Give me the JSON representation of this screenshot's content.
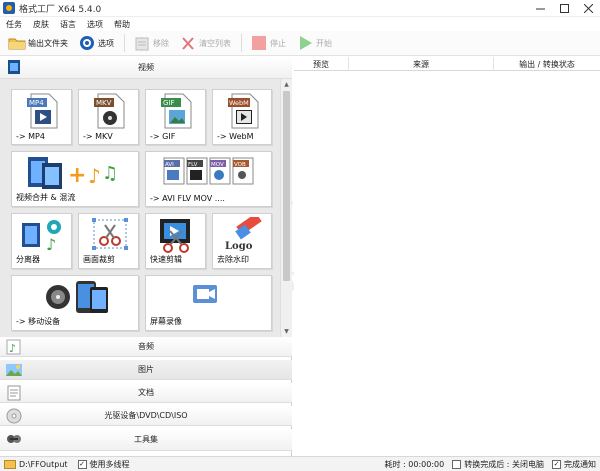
{
  "window": {
    "title": "格式工厂 X64 5.4.0"
  },
  "menu": {
    "items": [
      "任务",
      "皮肤",
      "语言",
      "选项",
      "帮助"
    ]
  },
  "toolbar": {
    "output_folder": "输出文件夹",
    "options": "选项",
    "remove": "移除",
    "clear_list": "清空列表",
    "stop": "停止",
    "start": "开始"
  },
  "categories": {
    "video": "视频",
    "audio": "音频",
    "image": "图片",
    "document": "文档",
    "rom": "光驱设备\\DVD\\CD\\ISO",
    "toolbox": "工具集"
  },
  "tiles": {
    "mp4": {
      "label": "-> MP4",
      "badge": "MP4"
    },
    "mkv": {
      "label": "-> MKV",
      "badge": "MKV"
    },
    "gif": {
      "label": "-> GIF",
      "badge": "GIF"
    },
    "webm": {
      "label": "-> WebM",
      "badge": "WebM"
    },
    "merge": {
      "label": "视频合并 & 混流"
    },
    "multi": {
      "label": "-> AVI FLV MOV ....",
      "badges": [
        "AVI",
        "FLV",
        "MOV",
        "VOB"
      ]
    },
    "splitter": {
      "label": "分离器"
    },
    "crop": {
      "label": "画面裁剪"
    },
    "quickcut": {
      "label": "快速剪辑"
    },
    "logo": {
      "label": "去除水印",
      "logo_text": "Logo"
    },
    "mobile": {
      "label": "-> 移动设备"
    },
    "recorder": {
      "label": "屏幕录像"
    }
  },
  "table": {
    "columns": [
      "预览",
      "来源",
      "输出 / 转换状态"
    ]
  },
  "status": {
    "path": "D:\\FFOutput",
    "multithread": "使用多线程",
    "elapsed": "耗时 : 00:00:00",
    "after_convert": "转换完成后 : 关闭电脑",
    "notify": "完成通知"
  },
  "colors": {
    "accent_blue": "#1e5fb4",
    "start_green": "#4caf50",
    "stop_red": "#e57373"
  }
}
